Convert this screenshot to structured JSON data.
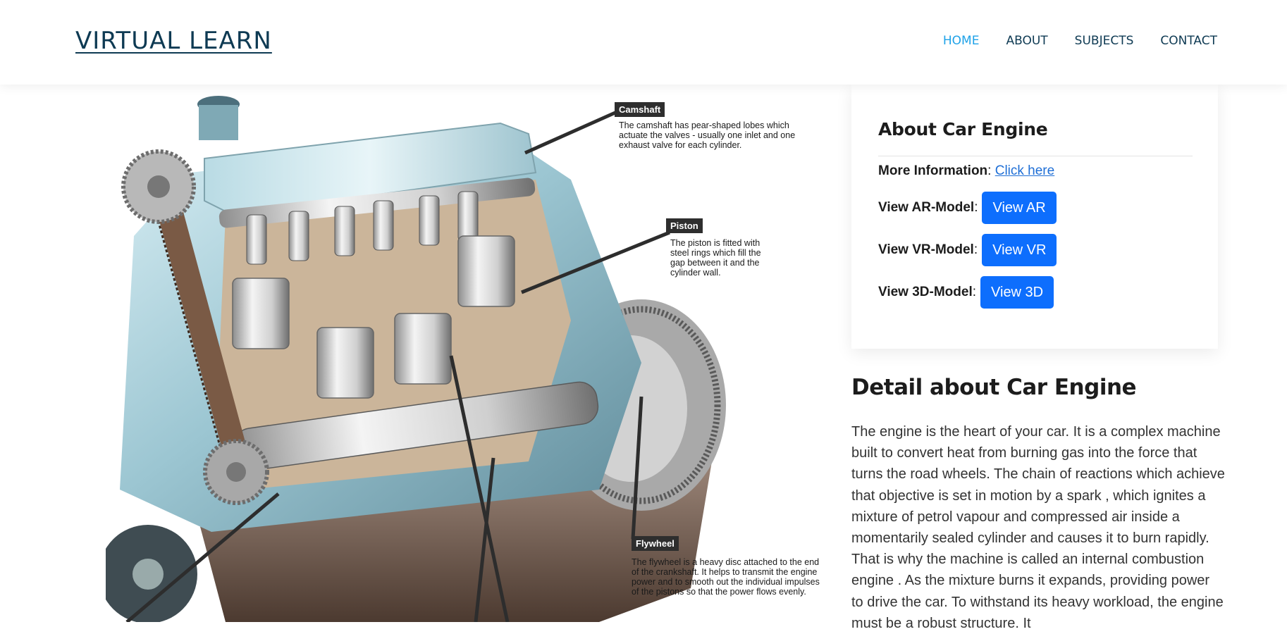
{
  "header": {
    "logo": "VIRTUAL LEARN",
    "nav": [
      {
        "label": "HOME",
        "active": true
      },
      {
        "label": "ABOUT",
        "active": false
      },
      {
        "label": "SUBJECTS",
        "active": false
      },
      {
        "label": "CONTACT",
        "active": false
      }
    ]
  },
  "illustration": {
    "callouts": [
      {
        "tag": "Camshaft",
        "text": "The camshaft has pear-shaped lobes which actuate the valves - usually one inlet and one exhaust valve for each cylinder."
      },
      {
        "tag": "Piston",
        "text": "The piston is fitted with steel rings which fill the gap between it and the cylinder wall."
      },
      {
        "tag": "Flywheel",
        "text": "The flywheel is a heavy disc attached to the end of the crankshaft. It helps to transmit the engine power and to smooth out the individual impulses of the pistons so that the power flows evenly."
      }
    ]
  },
  "about": {
    "title": "About Car Engine",
    "more_info_label": "More Information",
    "more_info_link": "Click here",
    "ar_label": "View AR-Model",
    "ar_button": "View AR",
    "vr_label": "View VR-Model",
    "vr_button": "View VR",
    "model3d_label": "View 3D-Model",
    "model3d_button": "View 3D"
  },
  "detail": {
    "title": "Detail about Car Engine",
    "text": "The engine is the heart of your car. It is a complex machine built to convert heat from burning gas into the force that turns the road wheels. The chain of reactions which achieve that objective is set in motion by a spark , which ignites a mixture of petrol vapour and compressed air inside a momentarily sealed cylinder and causes it to burn rapidly. That is why the machine is called an internal combustion engine . As the mixture burns it expands, providing power to drive the car. To withstand its heavy workload, the engine must be a robust structure. It"
  }
}
